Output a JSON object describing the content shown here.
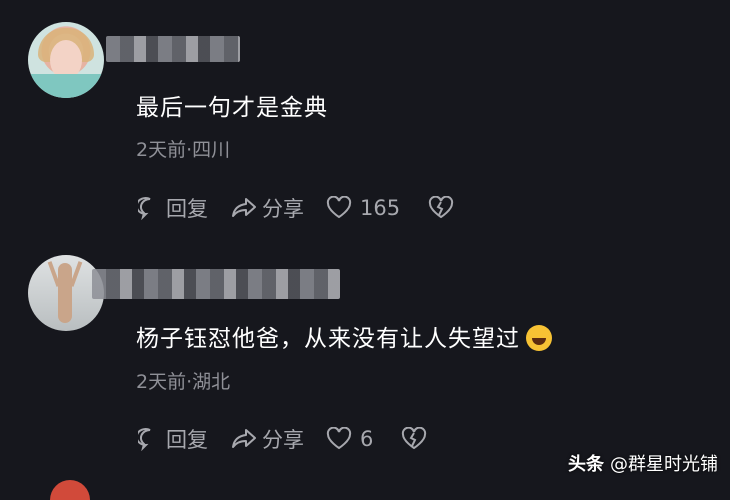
{
  "comments": [
    {
      "text": "最后一句才是金典",
      "meta": "2天前·四川",
      "reply_label": "回复",
      "share_label": "分享",
      "like_count": "165"
    },
    {
      "text": "杨子钰怼他爸，从来没有让人失望过",
      "meta": "2天前·湖北",
      "reply_label": "回复",
      "share_label": "分享",
      "like_count": "6",
      "emoji": "rolling-laughing-emoji"
    }
  ],
  "watermark": {
    "brand": "头条",
    "account": "@群星时光铺"
  },
  "icons": [
    "reply-icon",
    "share-icon",
    "heart-icon",
    "dislike-icon"
  ],
  "colors": {
    "background": "#16171d",
    "text": "#ffffff",
    "meta": "#8f9097",
    "action": "#a7a8ae"
  }
}
